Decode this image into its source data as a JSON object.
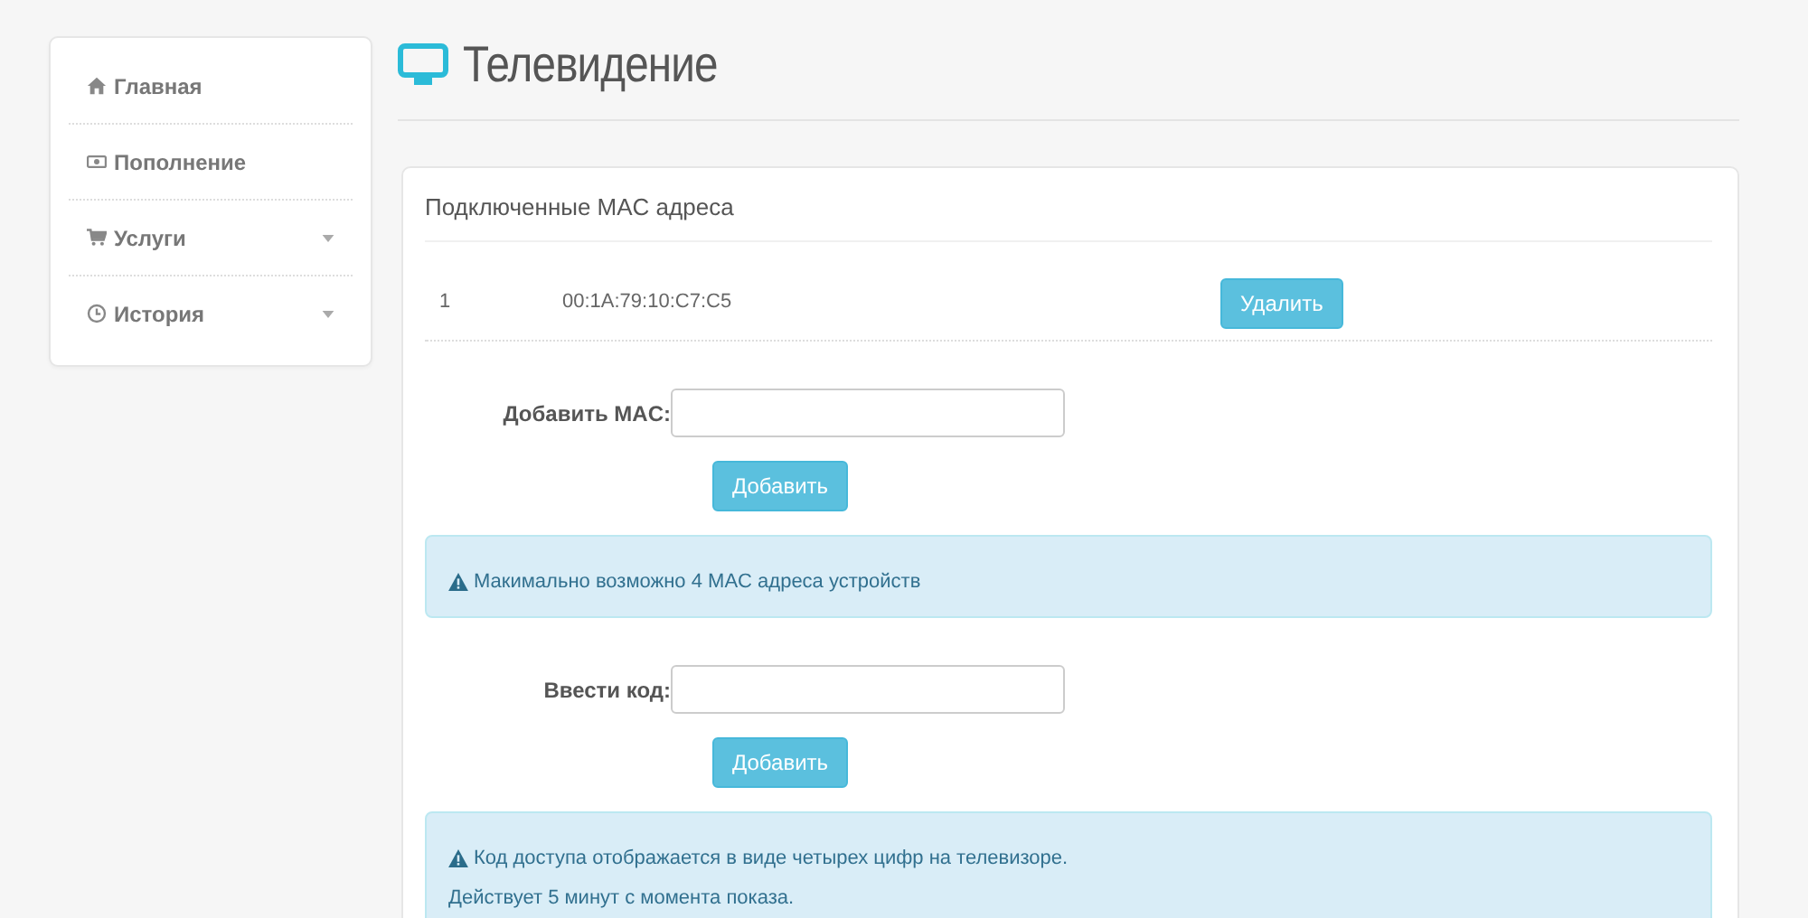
{
  "sidebar": {
    "items": [
      {
        "label": "Главная",
        "dropdown": false
      },
      {
        "label": "Пополнение",
        "dropdown": false
      },
      {
        "label": "Услуги",
        "dropdown": true
      },
      {
        "label": "История",
        "dropdown": true
      }
    ]
  },
  "page": {
    "title": "Телевидение"
  },
  "panel": {
    "heading": "Подключенные MAC адреса",
    "rows": [
      {
        "index": "1",
        "mac": "00:1A:79:10:C7:C5",
        "button": "Удалить"
      }
    ],
    "forms": [
      {
        "label": "Добавить MAC:",
        "button": "Добавить",
        "alert": [
          "Макимально возможно 4 MAC адреса устройств"
        ]
      },
      {
        "label": "Ввести код:",
        "button": "Добавить",
        "alert": [
          "Код доступа отображается в виде четырех цифр на телевизоре.",
          "Действует 5 минут с момента показа."
        ]
      }
    ]
  }
}
